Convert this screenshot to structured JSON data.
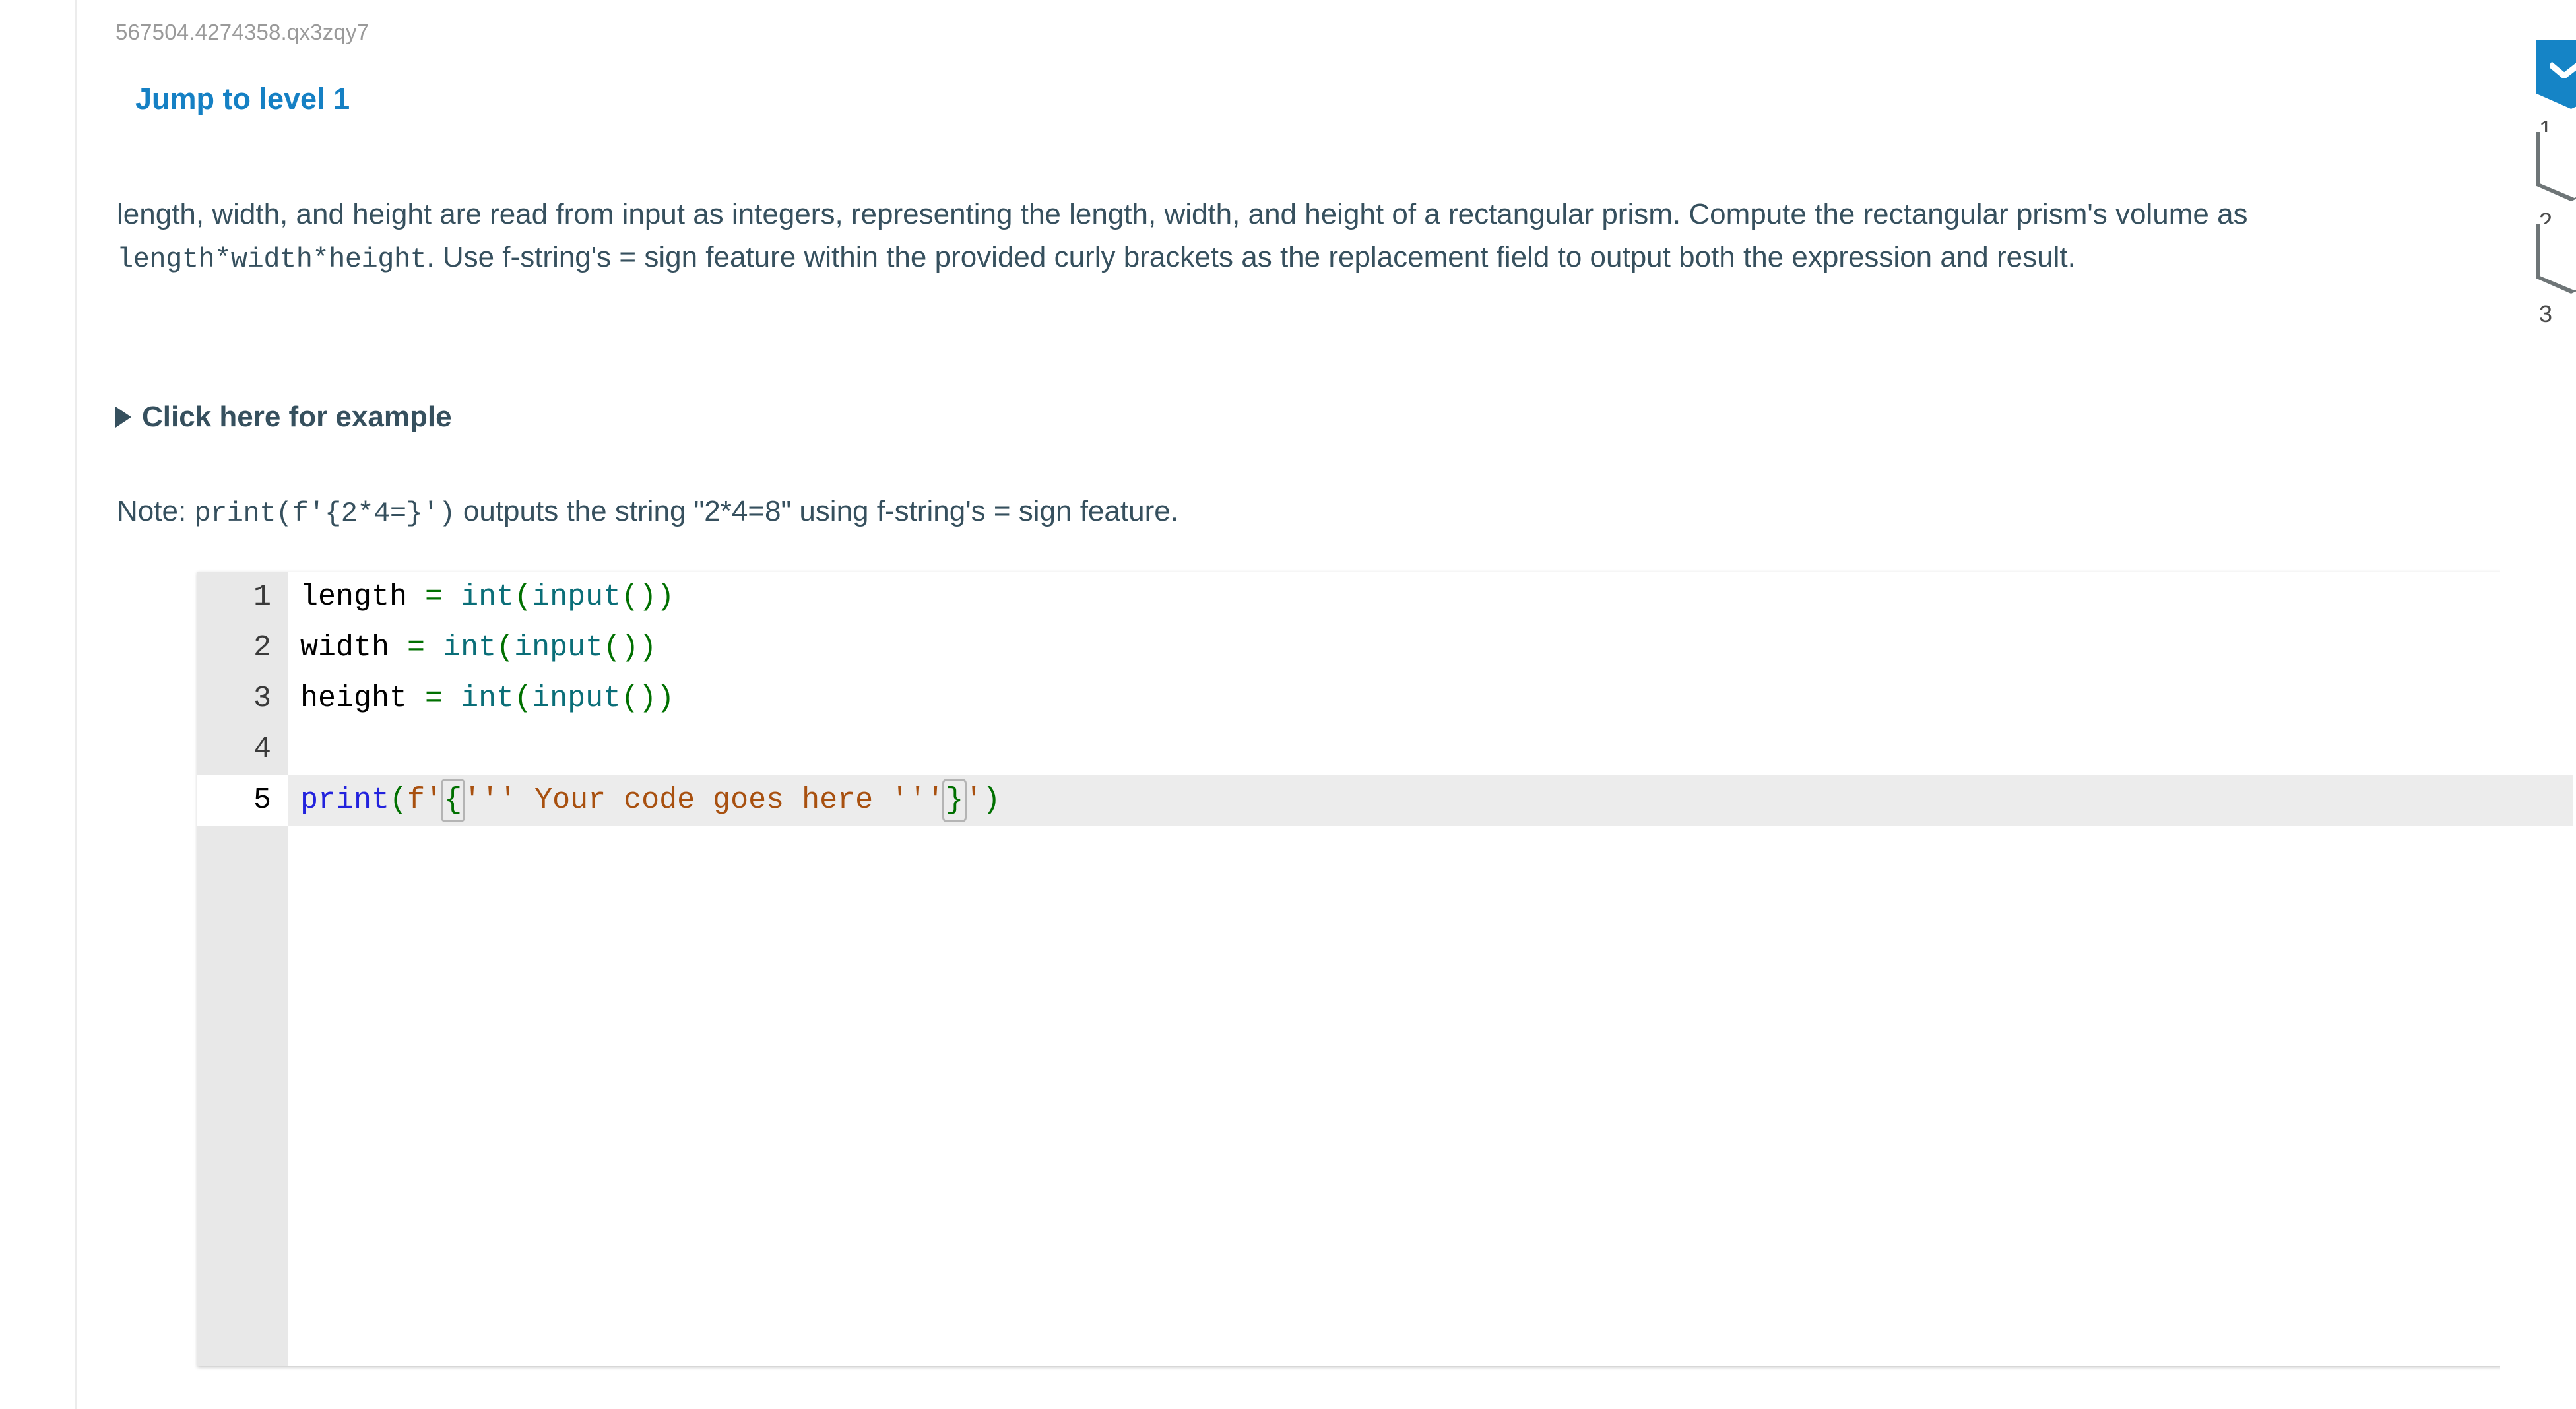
{
  "activity": {
    "id_label": "567504.4274358.qx3zqy7",
    "jump_link": "Jump to level 1"
  },
  "prompt": {
    "line1": "length, width, and height are read from input as integers, representing the length, width, and height of a rectangular prism.",
    "line2_a": "Compute the rectangular prism's volume as ",
    "line2_code": "length*width*height",
    "line2_b": ". Use f-string's = sign feature within the provided curly",
    "line3": "brackets as the replacement field to output both the expression and result."
  },
  "example": {
    "toggle_label": "Click here for example",
    "toggle_icon": "triangle-right-icon"
  },
  "note": {
    "prefix": "Note: ",
    "code": "print(f'{2*4=}')",
    "suffix": " outputs the string \"2*4=8\" using f-string's = sign feature."
  },
  "editor": {
    "language": "python",
    "active_line": 5,
    "lines": [
      {
        "num": "1",
        "tokens": [
          {
            "t": "length",
            "c": "tok-plain"
          },
          {
            "t": " ",
            "c": "tok-plain"
          },
          {
            "t": "=",
            "c": "tok-op"
          },
          {
            "t": " ",
            "c": "tok-plain"
          },
          {
            "t": "int",
            "c": "tok-fn"
          },
          {
            "t": "(",
            "c": "tok-paren"
          },
          {
            "t": "input",
            "c": "tok-fn"
          },
          {
            "t": "()",
            "c": "tok-paren"
          },
          {
            "t": ")",
            "c": "tok-paren"
          }
        ]
      },
      {
        "num": "2",
        "tokens": [
          {
            "t": "width",
            "c": "tok-plain"
          },
          {
            "t": " ",
            "c": "tok-plain"
          },
          {
            "t": "=",
            "c": "tok-op"
          },
          {
            "t": " ",
            "c": "tok-plain"
          },
          {
            "t": "int",
            "c": "tok-fn"
          },
          {
            "t": "(",
            "c": "tok-paren"
          },
          {
            "t": "input",
            "c": "tok-fn"
          },
          {
            "t": "()",
            "c": "tok-paren"
          },
          {
            "t": ")",
            "c": "tok-paren"
          }
        ]
      },
      {
        "num": "3",
        "tokens": [
          {
            "t": "height",
            "c": "tok-plain"
          },
          {
            "t": " ",
            "c": "tok-plain"
          },
          {
            "t": "=",
            "c": "tok-op"
          },
          {
            "t": " ",
            "c": "tok-plain"
          },
          {
            "t": "int",
            "c": "tok-fn"
          },
          {
            "t": "(",
            "c": "tok-paren"
          },
          {
            "t": "input",
            "c": "tok-fn"
          },
          {
            "t": "()",
            "c": "tok-paren"
          },
          {
            "t": ")",
            "c": "tok-paren"
          }
        ]
      },
      {
        "num": "4",
        "tokens": []
      },
      {
        "num": "5",
        "tokens": [
          {
            "t": "print",
            "c": "tok-builtin"
          },
          {
            "t": "(",
            "c": "tok-paren"
          },
          {
            "t": "f'",
            "c": "tok-str"
          },
          {
            "t": "{",
            "c": "tok-brace",
            "bracket_match": true
          },
          {
            "t": "''' Your code goes here '''",
            "c": "tok-str"
          },
          {
            "t": "}",
            "c": "tok-brace",
            "bracket_match": true
          },
          {
            "t": "'",
            "c": "tok-str"
          },
          {
            "t": ")",
            "c": "tok-paren"
          }
        ]
      }
    ],
    "source_text": "length = int(input())\nwidth = int(input())\nheight = int(input())\n\nprint(f'{''' Your code goes here '''}')"
  },
  "progress": {
    "levels": [
      {
        "num": "1",
        "state": "done",
        "icon": "check-icon"
      },
      {
        "num": "2",
        "state": "todo",
        "icon": "empty-badge-icon"
      },
      {
        "num": "3",
        "state": "todo",
        "icon": "empty-badge-icon"
      }
    ]
  },
  "colors": {
    "link_blue": "#1580c4",
    "badge_done": "#1584c6",
    "badge_outline": "#6e7577",
    "body_text": "#36505e",
    "muted": "#9a9a9a"
  }
}
